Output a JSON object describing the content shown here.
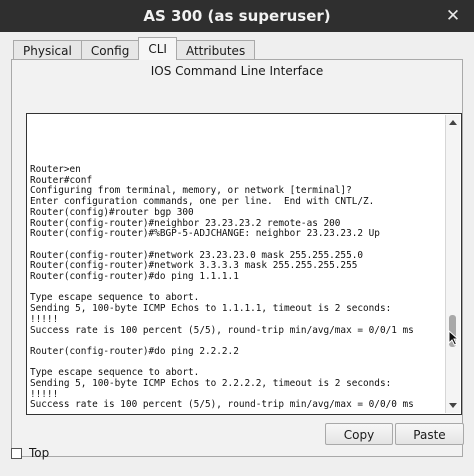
{
  "window": {
    "title": "AS 300 (as superuser)",
    "close_glyph": "✕"
  },
  "tabs": [
    {
      "label": "Physical"
    },
    {
      "label": "Config"
    },
    {
      "label": "CLI"
    },
    {
      "label": "Attributes"
    }
  ],
  "panel": {
    "title": "IOS Command Line Interface"
  },
  "terminal": {
    "text": "Router>en\nRouter#conf\nConfiguring from terminal, memory, or network [terminal]?\nEnter configuration commands, one per line.  End with CNTL/Z.\nRouter(config)#router bgp 300\nRouter(config-router)#neighbor 23.23.23.2 remote-as 200\nRouter(config-router)#%BGP-5-ADJCHANGE: neighbor 23.23.23.2 Up\n\nRouter(config-router)#network 23.23.23.0 mask 255.255.255.0\nRouter(config-router)#network 3.3.3.3 mask 255.255.255.255\nRouter(config-router)#do ping 1.1.1.1\n\nType escape sequence to abort.\nSending 5, 100-byte ICMP Echos to 1.1.1.1, timeout is 2 seconds:\n!!!!!\nSuccess rate is 100 percent (5/5), round-trip min/avg/max = 0/0/1 ms\n\nRouter(config-router)#do ping 2.2.2.2\n\nType escape sequence to abort.\nSending 5, 100-byte ICMP Echos to 2.2.2.2, timeout is 2 seconds:\n!!!!!\nSuccess rate is 100 percent (5/5), round-trip min/avg/max = 0/0/0 ms"
  },
  "buttons": {
    "copy": "Copy",
    "paste": "Paste"
  },
  "footer": {
    "top_label": "Top",
    "top_checked": false
  },
  "icons": {
    "close": "close-icon",
    "scroll_up": "chevron-up-icon",
    "scroll_down": "chevron-down-icon",
    "cursor": "mouse-pointer-icon"
  }
}
